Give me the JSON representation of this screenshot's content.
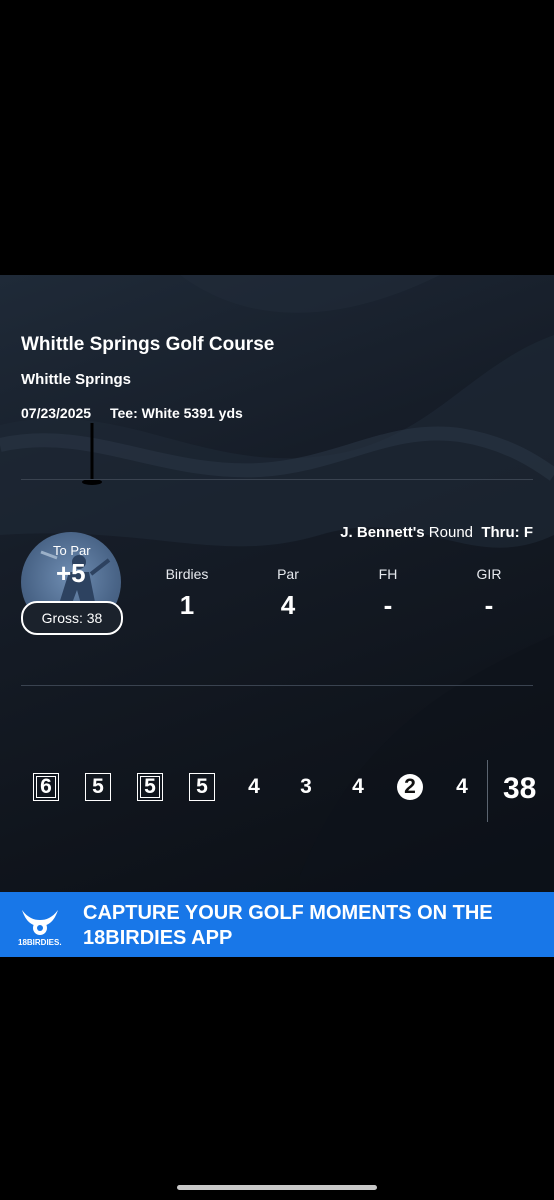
{
  "course": {
    "name": "Whittle Springs Golf Course",
    "location": "Whittle Springs",
    "date": "07/23/2025",
    "tee": "Tee: White 5391 yds"
  },
  "round": {
    "player": "J. Bennett's",
    "round_word": "Round",
    "thru": "Thru: F"
  },
  "summary": {
    "to_par_label": "To Par",
    "to_par_value": "+5",
    "gross": "Gross: 38",
    "stats": [
      {
        "label": "Birdies",
        "value": "1"
      },
      {
        "label": "Par",
        "value": "4"
      },
      {
        "label": "FH",
        "value": "-"
      },
      {
        "label": "GIR",
        "value": "-"
      }
    ]
  },
  "scores": [
    {
      "value": "6",
      "style": "double-box"
    },
    {
      "value": "5",
      "style": "box"
    },
    {
      "value": "5",
      "style": "double-box"
    },
    {
      "value": "5",
      "style": "box"
    },
    {
      "value": "4",
      "style": "plain"
    },
    {
      "value": "3",
      "style": "plain"
    },
    {
      "value": "4",
      "style": "plain"
    },
    {
      "value": "2",
      "style": "circle"
    },
    {
      "value": "4",
      "style": "plain"
    }
  ],
  "total": "38",
  "banner": {
    "text_line1": "CAPTURE YOUR GOLF MOMENTS ON THE",
    "text_line2": "18BIRDIES APP",
    "brand": "18BIRDIES.",
    "color": "#1877e8"
  }
}
